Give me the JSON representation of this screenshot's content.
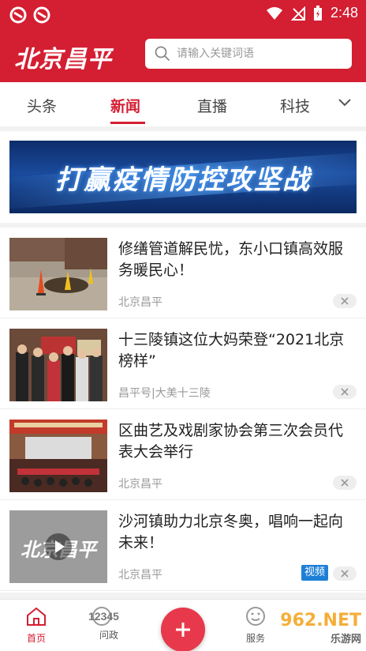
{
  "status_bar": {
    "time": "2:48"
  },
  "header": {
    "brand": "北京昌平",
    "search_placeholder": "请输入关键词语"
  },
  "tabs": [
    {
      "label": "头条"
    },
    {
      "label": "新闻",
      "active": true
    },
    {
      "label": "直播"
    },
    {
      "label": "科技"
    }
  ],
  "banner": {
    "text": "打赢疫情防控攻坚战"
  },
  "news": [
    {
      "title": "修缮管道解民忧，东小口镇高效服务暖民心！",
      "source": "北京昌平"
    },
    {
      "title": "十三陵镇这位大妈荣登“2021北京榜样”",
      "source": "昌平号|大美十三陵"
    },
    {
      "title": "区曲艺及戏剧家协会第三次会员代表大会举行",
      "source": "北京昌平"
    },
    {
      "title": "沙河镇助力北京冬奥，唱响一起向未来！",
      "source": "北京昌平",
      "tag": "视频",
      "thumb_text": "北京昌平"
    }
  ],
  "bottom_nav": {
    "home": "首页",
    "politics": "问政",
    "politics_icon_text": "12345",
    "service": "服务"
  },
  "watermark": {
    "main": "962.NET",
    "sub": "乐游网"
  },
  "colors": {
    "brand_red": "#d41e32",
    "video_tag_blue": "#1d7fd6",
    "plus_red": "#e8384c"
  }
}
